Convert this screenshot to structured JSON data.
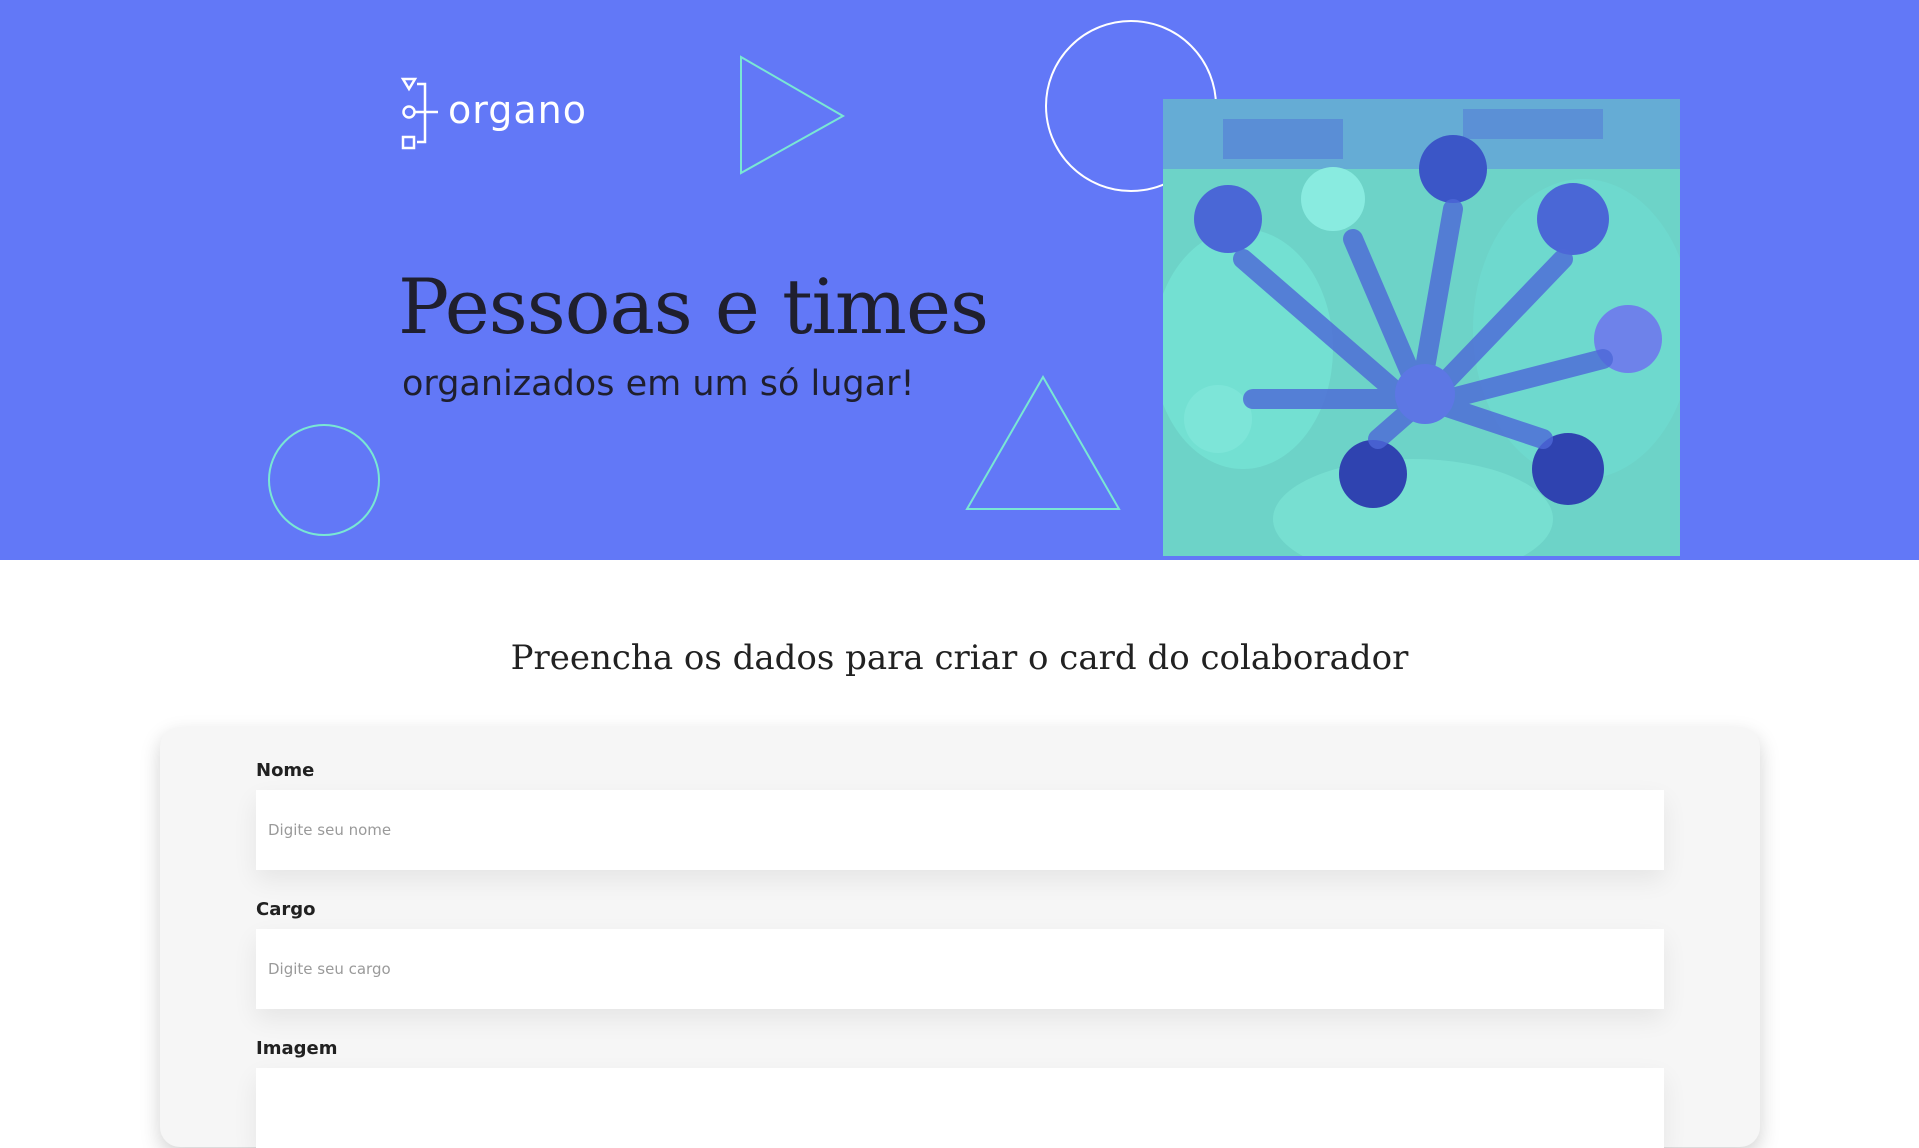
{
  "brand": {
    "name": "organo",
    "primary_color": "#6278F7",
    "accent_color": "#6BD1FF",
    "shape_stroke_color": "#79E7D4"
  },
  "hero": {
    "title": "Pessoas e times",
    "subtitle": "organizados em um só lugar!",
    "image_icon": "team-hands-together-photo"
  },
  "form": {
    "heading": "Preencha os dados para criar o card do colaborador",
    "fields": [
      {
        "label": "Nome",
        "placeholder": "Digite seu nome",
        "value": ""
      },
      {
        "label": "Cargo",
        "placeholder": "Digite seu cargo",
        "value": ""
      },
      {
        "label": "Imagem",
        "placeholder": "",
        "value": ""
      }
    ]
  }
}
